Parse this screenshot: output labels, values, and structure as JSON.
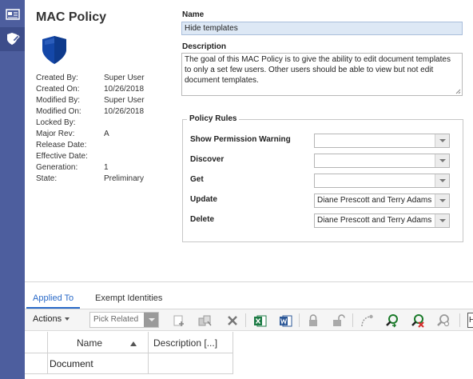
{
  "sidebar": {
    "items": [
      {
        "icon": "id-card-icon",
        "active": false
      },
      {
        "icon": "shield-pen-icon",
        "active": true
      }
    ]
  },
  "header": {
    "title": "MAC Policy",
    "icon": "shield-icon"
  },
  "properties": [
    {
      "label": "Created By:",
      "value": "Super User"
    },
    {
      "label": "Created On:",
      "value": "10/26/2018"
    },
    {
      "label": "Modified By:",
      "value": "Super User"
    },
    {
      "label": "Modified On:",
      "value": "10/26/2018"
    },
    {
      "label": "Locked By:",
      "value": ""
    },
    {
      "label": "Major Rev:",
      "value": "A"
    },
    {
      "label": "Release Date:",
      "value": ""
    },
    {
      "label": "Effective Date:",
      "value": ""
    },
    {
      "label": "Generation:",
      "value": "1"
    },
    {
      "label": "State:",
      "value": "Preliminary"
    }
  ],
  "form": {
    "name_label": "Name",
    "name_value": "Hide templates",
    "description_label": "Description",
    "description_value": "The goal of this MAC Policy is to give the ability to edit document templates to only a set few users. Other users should be able to view but not edit document templates."
  },
  "policy_rules": {
    "title": "Policy Rules",
    "rules": [
      {
        "label": "Show Permission Warning",
        "value": ""
      },
      {
        "label": "Discover",
        "value": ""
      },
      {
        "label": "Get",
        "value": ""
      },
      {
        "label": "Update",
        "value": "Diane Prescott and Terry Adams"
      },
      {
        "label": "Delete",
        "value": "Diane Prescott and Terry Adams"
      }
    ]
  },
  "tabs": [
    {
      "label": "Applied To",
      "active": true
    },
    {
      "label": "Exempt Identities",
      "active": false
    }
  ],
  "toolbar": {
    "actions_label": "Actions",
    "pick_related_placeholder": "Pick Related",
    "right_box_text": "H",
    "icons": [
      "add-item-icon",
      "pick-items-icon",
      "delete-icon",
      "excel-icon",
      "word-icon",
      "lock-icon",
      "unlock-icon",
      "promote-icon",
      "where-used-icon",
      "where-used-remove-icon",
      "structure-browser-icon"
    ]
  },
  "grid": {
    "columns": [
      "Name",
      "Description [...]"
    ],
    "rows": [
      {
        "name": "Document",
        "description": ""
      }
    ]
  },
  "colors": {
    "sidebar": "#4d5e9e",
    "accent": "#2a6ac8",
    "shield": "#1447a8",
    "name_field_bg": "#dde8f5"
  }
}
